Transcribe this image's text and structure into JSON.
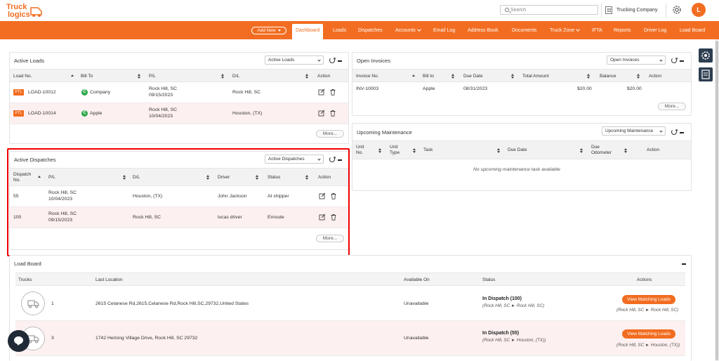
{
  "brand": {
    "logo_top": "Truck",
    "logo_bottom": "logics",
    "accent": "#f26d21"
  },
  "header": {
    "search_placeholder": "Search",
    "company": "Trucking Company",
    "avatar_initial": "L"
  },
  "nav": {
    "add_new": "Add New",
    "items": [
      "Dashboard",
      "Loads",
      "Dispatches",
      "Accounts",
      "Email Log",
      "Address Book",
      "Documents",
      "Truck Zone",
      "IFTA",
      "Reports",
      "Driver Log",
      "Load Board"
    ]
  },
  "active_loads": {
    "title": "Active Loads",
    "select": "Active Loads",
    "columns": [
      "Load No.",
      "Bill To",
      "P/L",
      "D/L",
      "Action"
    ],
    "rows": [
      {
        "badge": "FTL",
        "load_no": "LOAD-10012",
        "bill_initial": "C",
        "bill_to": "Company",
        "pl_city": "Rock Hill, SC",
        "pl_date": "09/15/2023",
        "dl": "Rock Hill, SC"
      },
      {
        "badge": "FTL",
        "load_no": "LOAD-10014",
        "bill_initial": "C",
        "bill_to": "Apple",
        "pl_city": "Rock Hill, SC",
        "pl_date": "10/04/2023",
        "dl": "Houston, (TX)"
      }
    ],
    "more": "More..."
  },
  "active_dispatches": {
    "title": "Active Dispatches",
    "select": "Active Dispatches",
    "columns": [
      "Dispatch No.",
      "P/L",
      "D/L",
      "Driver",
      "Status",
      "Action"
    ],
    "col0_line1": "Dispatch",
    "col0_line2": "No.",
    "rows": [
      {
        "no": "55",
        "pl_city": "Rock Hill, SC",
        "pl_date": "10/04/2023",
        "dl": "Houston, (TX)",
        "driver": "John Jackson",
        "status": "At shipper"
      },
      {
        "no": "100",
        "pl_city": "Rock Hill, SC",
        "pl_date": "09/15/2023",
        "dl": "Rock Hill, SC",
        "driver": "lucas driver",
        "status": "Enroute"
      }
    ],
    "more": "More..."
  },
  "open_invoices": {
    "title": "Open Invoices",
    "select": "Open Invoices",
    "columns": [
      "Invoice No.",
      "Bill to",
      "Due Date",
      "Total Amount",
      "Balance",
      "Action"
    ],
    "rows": [
      {
        "invoice_no": "INV-10003",
        "bill_to": "Apple",
        "due_date": "08/31/2023",
        "total": "$20.00",
        "balance": "$20.00"
      }
    ],
    "more": "More..."
  },
  "upcoming_maintenance": {
    "title": "Upcoming Maintenance",
    "select": "Upcoming Maintenance",
    "columns": {
      "unit_no_1": "Unit",
      "unit_no_2": "No.",
      "unit_type_1": "Unit",
      "unit_type_2": "Type",
      "task": "Task",
      "due_date": "Due Date",
      "due_odo_1": "Due",
      "due_odo_2": "Odometer",
      "action": "Action"
    },
    "empty": "No upcoming maintenance task available"
  },
  "load_board": {
    "title": "Load Board",
    "columns": [
      "Trucks",
      "Last Location",
      "Available On",
      "Status",
      "Actions"
    ],
    "rows": [
      {
        "truck": "1",
        "location": "2615 Celanese Rd,2615,Celanese Rd,Rock Hill,SC,29732,United States",
        "available": "Unavailable",
        "status": "In Dispatch (100)",
        "status_route": "(Rock Hill, SC ► Rock Hill, SC)",
        "button": "View Matching Loads",
        "action_route": "(Rock Hill, SC ► Rock Hill, SC)"
      },
      {
        "truck": "3",
        "location": "1742 Herlong Village Drive, Rock Hill, SC 29732",
        "available": "Unavailable",
        "status": "In Dispatch (55)",
        "status_route": "(Rock Hill, SC ► Houston, (TX))",
        "button": "View Matching Loads",
        "action_route": "(Rock Hill, SC ► Houston, (TX))"
      }
    ]
  }
}
